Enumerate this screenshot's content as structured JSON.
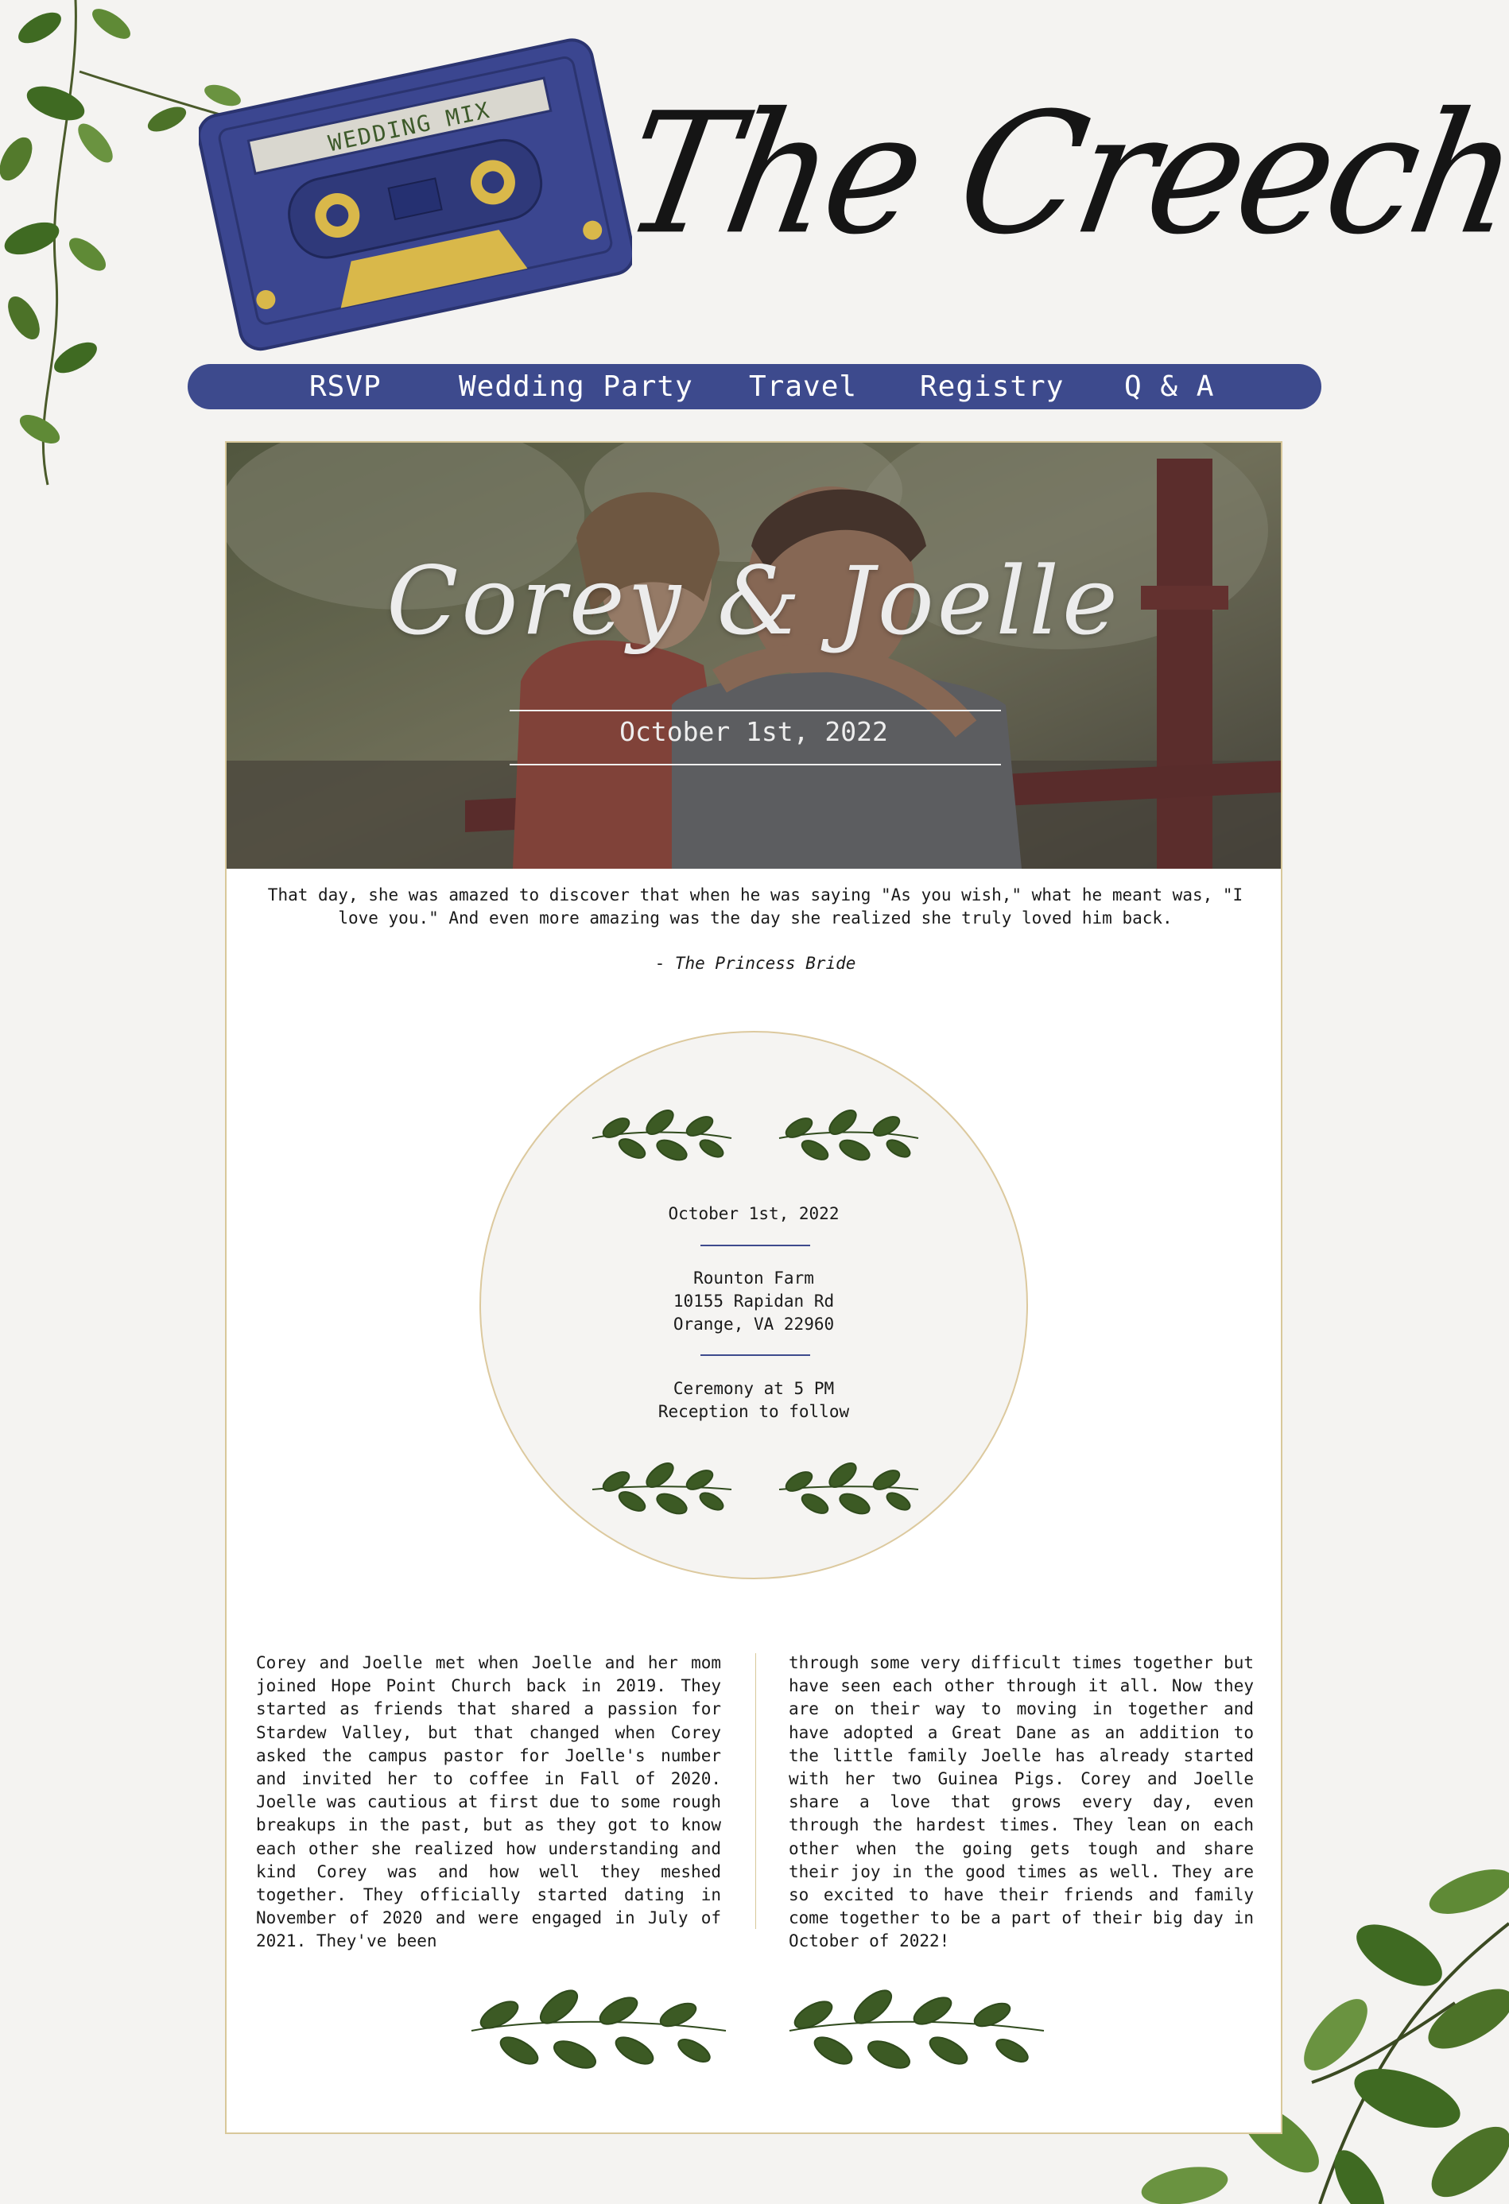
{
  "header": {
    "site_title": "The Creechans",
    "cassette_label": "WEDDING MIX"
  },
  "nav": {
    "items": [
      "RSVP",
      "Wedding Party",
      "Travel",
      "Registry",
      "Q & A"
    ]
  },
  "hero": {
    "title": "Corey & Joelle",
    "date": "October 1st, 2022"
  },
  "quote": {
    "text": "That day, she was amazed to discover that when he was saying \"As you wish,\" what he meant was, \"I love you.\" And even more amazing was the day she realized she truly loved him back.",
    "dash": "- ",
    "source": "The Princess Bride"
  },
  "details": {
    "date": "October 1st, 2022",
    "venue": "Rounton Farm",
    "street": "10155 Rapidan Rd",
    "city": "Orange, VA 22960",
    "ceremony": "Ceremony at 5 PM",
    "reception": "Reception to follow"
  },
  "story": {
    "left": "Corey and Joelle met when Joelle and her mom joined Hope Point Church back in 2019. They started as friends that shared a passion for Stardew Valley, but that changed when Corey asked the campus pastor for Joelle's number and invited her to coffee in Fall of 2020. Joelle was cautious at first due to some rough breakups in the past, but as they got to know each other she realized how understanding and kind Corey was and how well they meshed together. They officially started dating in November of 2020 and were engaged in July of 2021. They've been",
    "right": "through some very difficult times together but have seen each other through it all. Now they are on their way to moving in together and have adopted a Great Dane as an addition to the little family Joelle has already started with her two Guinea Pigs. Corey and Joelle share a love that grows every day, even through the hardest times. They lean on each other when the going gets tough and share their joy in the good times as well. They are so excited to have their friends and family come together to be a part of their big day in October of 2022!"
  },
  "colors": {
    "navy": "#3d4a8d",
    "gold": "#d8c89a",
    "leaf": "#3c5a24",
    "background": "#f4f3f1"
  }
}
